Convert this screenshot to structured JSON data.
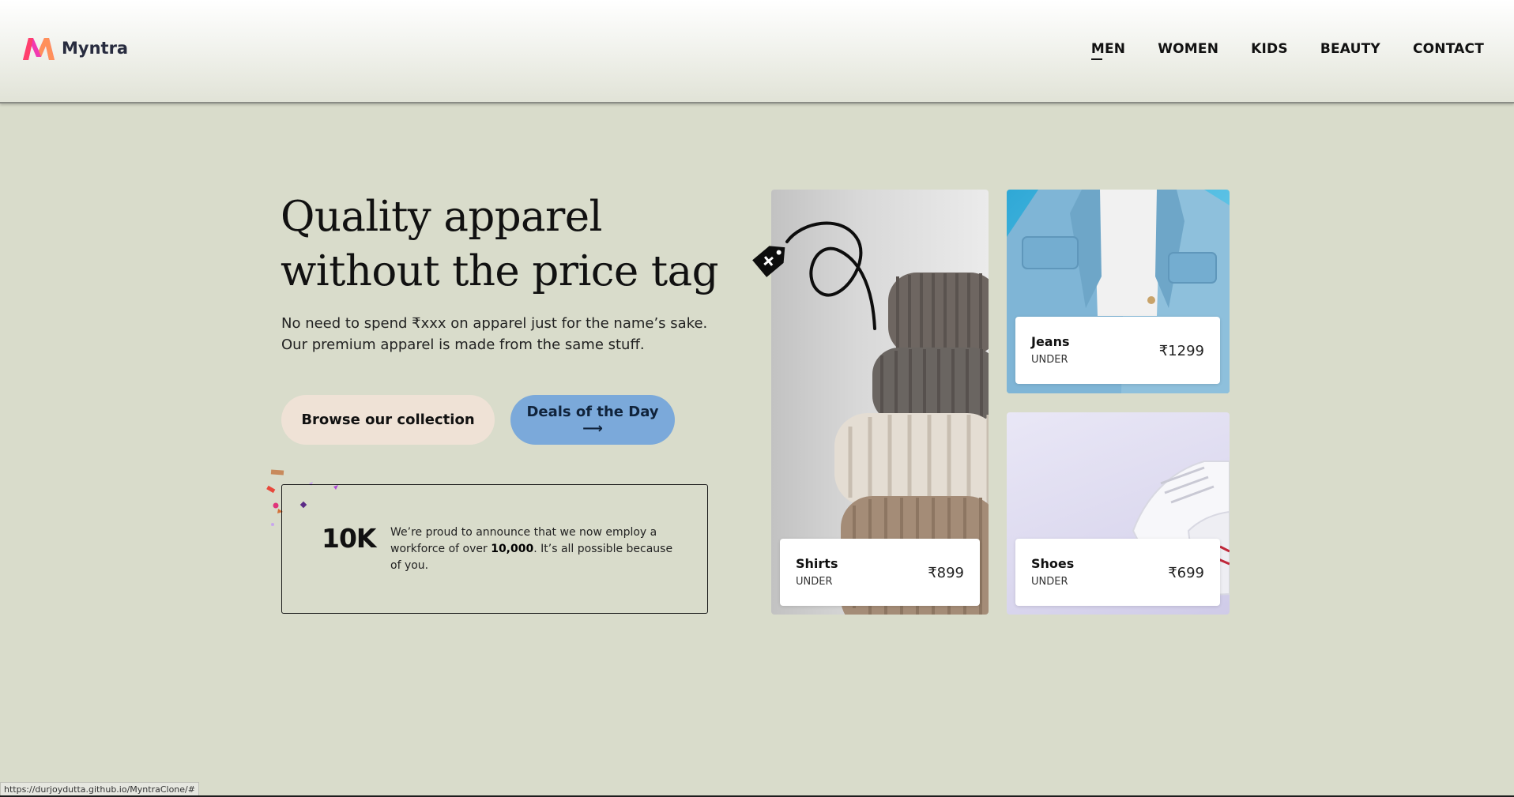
{
  "brand": {
    "name": "Myntra",
    "logo_icon": "myntra-m-logo",
    "logo_colors": [
      "#ff3f6c",
      "#f13ab1",
      "#ff905a"
    ]
  },
  "nav": {
    "items": [
      {
        "label": "MEN",
        "active": true
      },
      {
        "label": "WOMEN",
        "active": false
      },
      {
        "label": "KIDS",
        "active": false
      },
      {
        "label": "BEAUTY",
        "active": false
      },
      {
        "label": "CONTACT",
        "active": false
      }
    ]
  },
  "hero": {
    "title_line1": "Quality apparel",
    "title_line2": "without the price tag",
    "sub_line1": "No need to spend ₹xxx on apparel just for the name’s sake.",
    "sub_line2": "Our premium apparel is made from the same stuff."
  },
  "buttons": {
    "browse": "Browse our collection",
    "deals": "Deals of the Day ⟶"
  },
  "announcement": {
    "number": "10K",
    "text_before": "We’re proud to announce that we now employ a workforce of over ",
    "text_bold": "10,000",
    "text_after": ". It’s all possible because of you."
  },
  "products": [
    {
      "name": "Shirts",
      "label": "UNDER",
      "price": "₹899"
    },
    {
      "name": "Jeans",
      "label": "UNDER",
      "price": "₹1299"
    },
    {
      "name": "Shoes",
      "label": "UNDER",
      "price": "₹699"
    }
  ],
  "status_bar": {
    "url": "https://durjoydutta.github.io/MyntraClone/#"
  },
  "colors": {
    "page_bg": "#d9dccb",
    "browse_button": "#efe2d6",
    "deals_button": "#7ba9da"
  }
}
